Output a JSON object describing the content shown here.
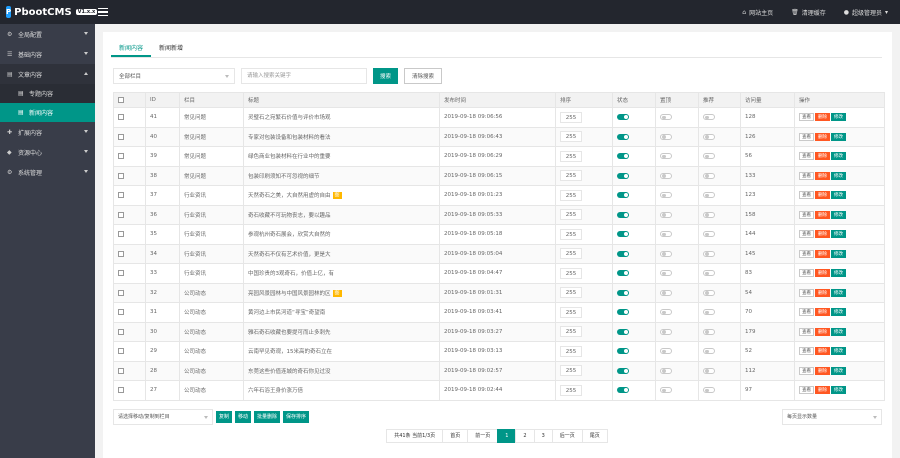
{
  "app": {
    "name": "PbootCMS",
    "version": "V1.x.x"
  },
  "topbar": {
    "links": [
      {
        "icon": "home-icon",
        "glyph": "⌂",
        "label": "网站主页"
      },
      {
        "icon": "trash-icon",
        "glyph": "🗑",
        "label": "清理缓存"
      },
      {
        "icon": "user-icon",
        "glyph": "●",
        "label": "超级管理员"
      }
    ]
  },
  "sidebar": {
    "items": [
      {
        "label": "全局配置",
        "glyph": "⚙"
      },
      {
        "label": "基础内容",
        "glyph": "☰"
      },
      {
        "label": "文章内容",
        "glyph": "▤"
      },
      {
        "label": "扩展内容",
        "glyph": "✚"
      },
      {
        "label": "资源中心",
        "glyph": "◆"
      },
      {
        "label": "系统管理",
        "glyph": "⚙"
      }
    ],
    "subitems": [
      {
        "label": "专题内容",
        "glyph": "▤"
      },
      {
        "label": "新闻内容",
        "glyph": "▤"
      }
    ]
  },
  "tabs": [
    "新闻内容",
    "新闻新增"
  ],
  "filters": {
    "category": "全部栏目",
    "search_placeholder": "请输入搜索关键字",
    "search_button": "搜索",
    "clear_button": "清除搜索"
  },
  "table": {
    "headers": [
      "",
      "ID",
      "栏目",
      "标题",
      "发布时间",
      "排序",
      "状态",
      "置顶",
      "推荐",
      "访问量",
      "操作"
    ],
    "ops": {
      "view": "查看",
      "delete": "删除",
      "edit": "修改"
    },
    "image_tag": "图",
    "rows": [
      {
        "id": "41",
        "cat": "常见问题",
        "title": "灵璧石之宛繁石价值与评价市场观",
        "time": "2019-09-18 09:06:56",
        "sort": "255",
        "views": "128",
        "img": false
      },
      {
        "id": "40",
        "cat": "常见问题",
        "title": "专家对包装设备和包装材料的看法",
        "time": "2019-09-18 09:06:43",
        "sort": "255",
        "views": "126",
        "img": false
      },
      {
        "id": "39",
        "cat": "常见问题",
        "title": "绿色商业包装材料在行业中的重要",
        "time": "2019-09-18 09:06:29",
        "sort": "255",
        "views": "56",
        "img": false
      },
      {
        "id": "38",
        "cat": "常见问题",
        "title": "包装印刷须知不可忽视的细节",
        "time": "2019-09-18 09:06:15",
        "sort": "255",
        "views": "133",
        "img": false
      },
      {
        "id": "37",
        "cat": "行业资讯",
        "title": "天然奇石之美，大自然用虚的自由",
        "time": "2019-09-18 09:01:23",
        "sort": "255",
        "views": "123",
        "img": true
      },
      {
        "id": "36",
        "cat": "行业资讯",
        "title": "奇石收藏不可玩物丧志，要以趣品",
        "time": "2019-09-18 09:05:33",
        "sort": "255",
        "views": "158",
        "img": false
      },
      {
        "id": "35",
        "cat": "行业资讯",
        "title": "参观杭州奇石展会，欣赏大自然的",
        "time": "2019-09-18 09:05:18",
        "sort": "255",
        "views": "144",
        "img": false
      },
      {
        "id": "34",
        "cat": "行业资讯",
        "title": "天然奇石不仅有艺术价值，更是大",
        "time": "2019-09-18 09:05:04",
        "sort": "255",
        "views": "145",
        "img": false
      },
      {
        "id": "33",
        "cat": "行业资讯",
        "title": "中国珍贵的3观奇石，价值上亿，有",
        "time": "2019-09-18 09:04:47",
        "sort": "255",
        "views": "83",
        "img": false
      },
      {
        "id": "32",
        "cat": "公司动态",
        "title": "亮园风景园林与中国风景园林的区",
        "time": "2019-09-18 09:01:31",
        "sort": "255",
        "views": "54",
        "img": true
      },
      {
        "id": "31",
        "cat": "公司动态",
        "title": "黄河边上市民河道“寻宝”奇望南",
        "time": "2019-09-18 09:03:41",
        "sort": "255",
        "views": "70",
        "img": false
      },
      {
        "id": "30",
        "cat": "公司动态",
        "title": "雅石奇石收藏也要提可而止多刺先",
        "time": "2019-09-18 09:03:27",
        "sort": "255",
        "views": "179",
        "img": false
      },
      {
        "id": "29",
        "cat": "公司动态",
        "title": "云南罕见奇观，15米高的奇石立在",
        "time": "2019-09-18 09:03:13",
        "sort": "255",
        "views": "52",
        "img": false
      },
      {
        "id": "28",
        "cat": "公司动态",
        "title": "东莞这些价值连城的奇石你见过没",
        "time": "2019-09-18 09:02:57",
        "sort": "255",
        "views": "112",
        "img": false
      },
      {
        "id": "27",
        "cat": "公司动态",
        "title": "六年石浴王身价涨万倍",
        "time": "2019-09-18 09:02:44",
        "sort": "255",
        "views": "97",
        "img": false
      }
    ]
  },
  "bottom": {
    "move_select": "请选择移动/复制到栏目",
    "buttons": [
      "复制",
      "移动",
      "批量删除",
      "保存排序"
    ],
    "pagesize": "每页显示数量"
  },
  "pager": {
    "info": "共41条 当前1/3页",
    "first": "首页",
    "prev": "前一页",
    "pages": [
      "1",
      "2",
      "3"
    ],
    "next": "后一页",
    "last": "尾页"
  },
  "colors": {
    "accent": "#009688",
    "danger": "#ff5722",
    "warn": "#ffb800",
    "sidebar": "#393d49",
    "topbar": "#23262e"
  }
}
